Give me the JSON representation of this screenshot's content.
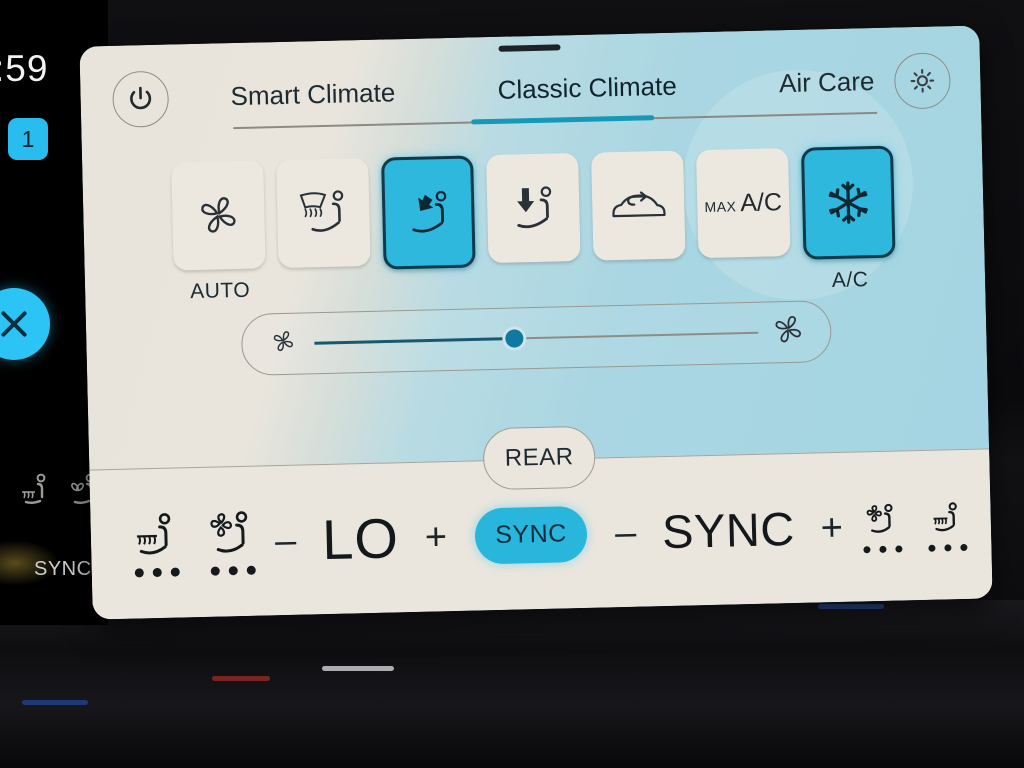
{
  "device": {
    "left_strip": {
      "clock_fragment": ":59",
      "badge_label": "1",
      "close_icon": "close-x-icon",
      "sync_label": "SYNC",
      "seat_icons": [
        "heated-seat-icon",
        "ventilated-seat-icon"
      ]
    }
  },
  "header": {
    "power_icon": "power-icon",
    "settings_icon": "gear-icon",
    "grab_handle": "drag-handle",
    "tabs": [
      {
        "label": "Smart Climate",
        "active": false
      },
      {
        "label": "Classic Climate",
        "active": true
      },
      {
        "label": "Air Care",
        "active": false
      }
    ]
  },
  "modes": [
    {
      "id": "auto",
      "icon": "fan-icon",
      "caption": "AUTO",
      "active": false
    },
    {
      "id": "defrost",
      "icon": "defrost-seat-icon",
      "caption": "",
      "active": false
    },
    {
      "id": "face-vent",
      "icon": "face-vent-seat-icon",
      "caption": "",
      "active": true
    },
    {
      "id": "floor-vent",
      "icon": "floor-vent-seat-icon",
      "caption": "",
      "active": false
    },
    {
      "id": "recirculate",
      "icon": "recirculation-icon",
      "caption": "",
      "active": false
    },
    {
      "id": "max-ac",
      "icon": "max-ac-text",
      "caption": "",
      "active": false
    },
    {
      "id": "ac",
      "icon": "snowflake-icon",
      "caption": "A/C",
      "active": true
    }
  ],
  "max_ac": {
    "prefix": "MAX",
    "suffix": "A/C"
  },
  "fan_slider": {
    "icon_low": "fan-small-icon",
    "icon_high": "fan-large-icon",
    "value_percent": 45
  },
  "bottom_bar": {
    "rear_label": "REAR",
    "left_seats": [
      {
        "icon": "heated-seat-icon",
        "level_dots": 3
      },
      {
        "icon": "ventilated-seat-icon",
        "level_dots": 3
      }
    ],
    "right_seats": [
      {
        "icon": "ventilated-seat-icon",
        "level_dots": 3
      },
      {
        "icon": "heated-seat-icon",
        "level_dots": 3
      }
    ],
    "left_temp": {
      "minus": "–",
      "value": "LO",
      "plus": "+"
    },
    "sync_button": {
      "label": "SYNC",
      "active": true
    },
    "right_temp": {
      "minus": "–",
      "value": "SYNC",
      "plus": "+"
    }
  },
  "colors": {
    "accent_cyan": "#2fb8dd",
    "accent_cyan_bright": "#29bcef",
    "tab_underline": "#1499b8",
    "panel_cream": "#e9e5dd",
    "panel_blue": "#a6d5e2",
    "text_dark": "#1d2b31",
    "bottom_bar": "#eae6de"
  }
}
